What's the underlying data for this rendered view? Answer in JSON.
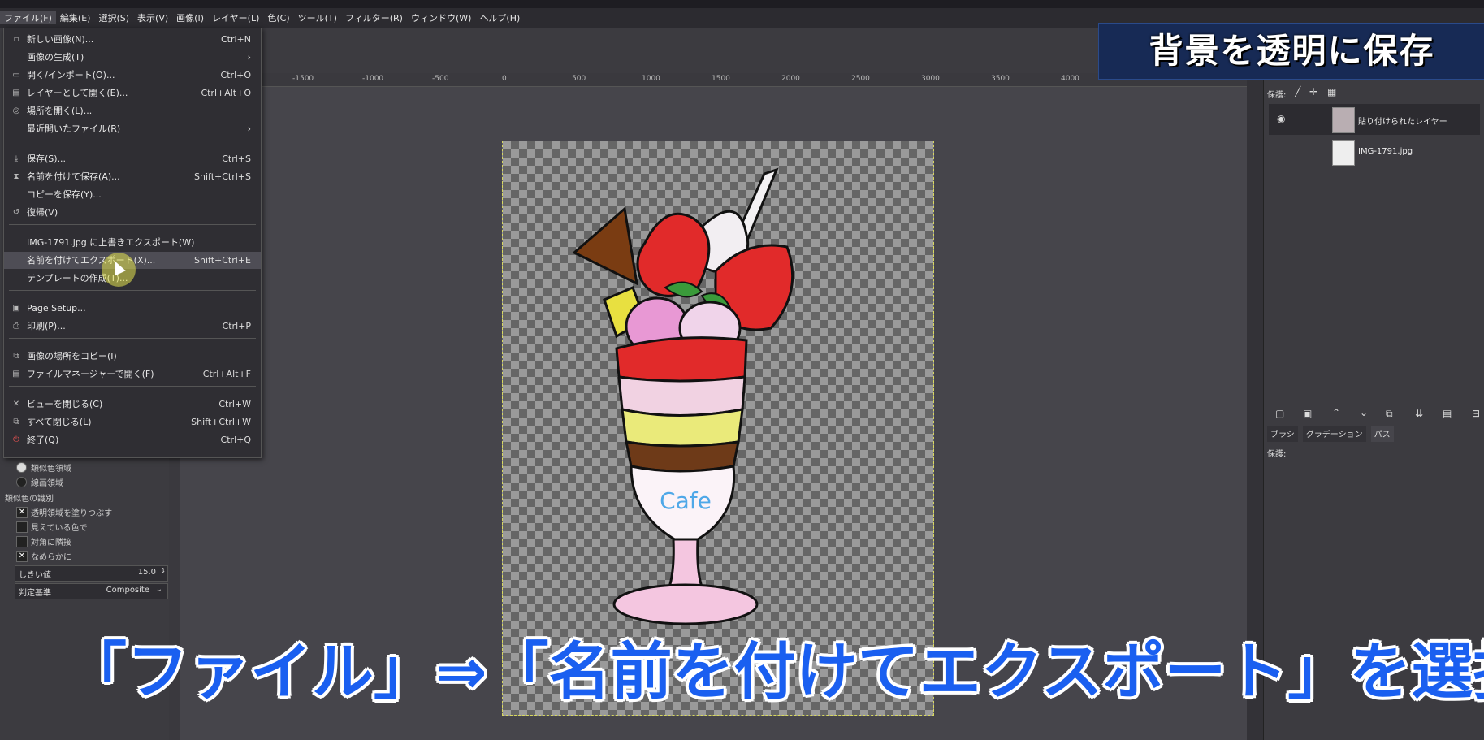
{
  "menubar": {
    "items": [
      "ファイル(F)",
      "編集(E)",
      "選択(S)",
      "表示(V)",
      "画像(I)",
      "レイヤー(L)",
      "色(C)",
      "ツール(T)",
      "フィルター(R)",
      "ウィンドウ(W)",
      "ヘルプ(H)"
    ]
  },
  "file_menu": {
    "items": [
      {
        "icon": "new-image-icon",
        "label": "新しい画像(N)...",
        "shortcut": "Ctrl+N"
      },
      {
        "icon": "",
        "label": "画像の生成(T)",
        "shortcut": "›"
      },
      {
        "icon": "open-icon",
        "label": "開く/インポート(O)...",
        "shortcut": "Ctrl+O"
      },
      {
        "icon": "open-as-layers-icon",
        "label": "レイヤーとして開く(E)...",
        "shortcut": "Ctrl+Alt+O"
      },
      {
        "icon": "open-location-icon",
        "label": "場所を開く(L)...",
        "shortcut": ""
      },
      {
        "icon": "",
        "label": "最近開いたファイル(R)",
        "shortcut": "›"
      },
      {
        "icon": "save-icon",
        "label": "保存(S)...",
        "shortcut": "Ctrl+S"
      },
      {
        "icon": "save-as-icon",
        "label": "名前を付けて保存(A)...",
        "shortcut": "Shift+Ctrl+S"
      },
      {
        "icon": "",
        "label": "コピーを保存(Y)...",
        "shortcut": ""
      },
      {
        "icon": "revert-icon",
        "label": "復帰(V)",
        "shortcut": ""
      },
      {
        "icon": "",
        "label": "IMG-1791.jpg に上書きエクスポート(W)",
        "shortcut": ""
      },
      {
        "icon": "",
        "label": "名前を付けてエクスポート(X)...",
        "shortcut": "Shift+Ctrl+E"
      },
      {
        "icon": "",
        "label": "テンプレートの作成(T)...",
        "shortcut": ""
      },
      {
        "icon": "page-setup-icon",
        "label": "Page Setup...",
        "shortcut": ""
      },
      {
        "icon": "print-icon",
        "label": "印刷(P)...",
        "shortcut": "Ctrl+P"
      },
      {
        "icon": "copy-location-icon",
        "label": "画像の場所をコピー(I)",
        "shortcut": ""
      },
      {
        "icon": "file-manager-icon",
        "label": "ファイルマネージャーで開く(F)",
        "shortcut": "Ctrl+Alt+F"
      },
      {
        "icon": "close-view-icon",
        "label": "ビューを閉じる(C)",
        "shortcut": "Ctrl+W"
      },
      {
        "icon": "close-all-icon",
        "label": "すべて閉じる(L)",
        "shortcut": "Shift+Ctrl+W"
      },
      {
        "icon": "quit-icon",
        "label": "終了(Q)",
        "shortcut": "Ctrl+Q"
      }
    ]
  },
  "tool_options": {
    "radio1": "類似色領域",
    "radio2": "線画領域",
    "section": "類似色の識別",
    "check1": "透明領域を塗りつぶす",
    "check2": "見えている色で",
    "check3": "対角に隣接",
    "check4": "なめらかに",
    "threshold_label": "しきい値",
    "threshold_value": "15.0",
    "criterion_label": "判定基準",
    "criterion_value": "Composite"
  },
  "ruler": [
    "-1500",
    "-1000",
    "-500",
    "0",
    "500",
    "1000",
    "1500",
    "2000",
    "2500",
    "3000",
    "3500",
    "4000",
    "4500"
  ],
  "layers": {
    "protect_label": "保護:",
    "items": [
      {
        "name": "貼り付けられたレイヤー"
      },
      {
        "name": "IMG-1791.jpg"
      }
    ]
  },
  "bottom_tabs": [
    "ブラシ",
    "グラデーション",
    "パス"
  ],
  "paths_protect": "保護:",
  "overlay": {
    "title": "背景を透明に保存",
    "caption": "「ファイル」⇒「名前を付けてエクスポート」を選択"
  },
  "artwork": {
    "cup_text": "Cafe"
  }
}
